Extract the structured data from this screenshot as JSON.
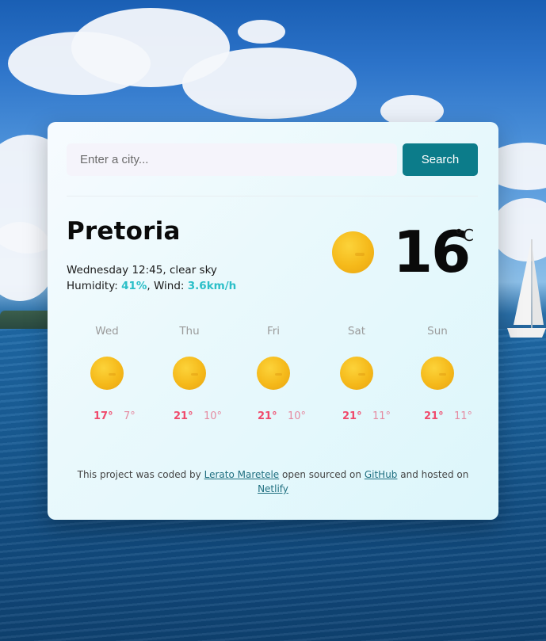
{
  "search": {
    "placeholder": "Enter a city...",
    "value": "",
    "button_label": "Search"
  },
  "current": {
    "city": "Pretoria",
    "datetime_desc": "Wednesday 12:45, clear sky",
    "humidity_label": "Humidity:",
    "humidity_value": "41%",
    "wind_label": "Wind:",
    "wind_value": "3.6km/h",
    "temperature": "16",
    "unit": "°C",
    "icon": "sun-icon"
  },
  "forecast": [
    {
      "day": "Wed",
      "max": "17°",
      "min": "7°",
      "icon": "sun-icon"
    },
    {
      "day": "Thu",
      "max": "21°",
      "min": "10°",
      "icon": "sun-icon"
    },
    {
      "day": "Fri",
      "max": "21°",
      "min": "10°",
      "icon": "sun-icon"
    },
    {
      "day": "Sat",
      "max": "21°",
      "min": "11°",
      "icon": "sun-icon"
    },
    {
      "day": "Sun",
      "max": "21°",
      "min": "11°",
      "icon": "sun-icon"
    }
  ],
  "footer": {
    "text_1": "This project was coded by",
    "author": "Lerato Maretele",
    "text_2": "open sourced on",
    "github": "GitHub",
    "text_3": "and hosted on",
    "netlify": "Netlify"
  },
  "colors": {
    "accent": "#2bbfc8",
    "button": "#0c7c8a",
    "temp_max": "#f04a6c",
    "temp_min": "#e58aa0"
  }
}
